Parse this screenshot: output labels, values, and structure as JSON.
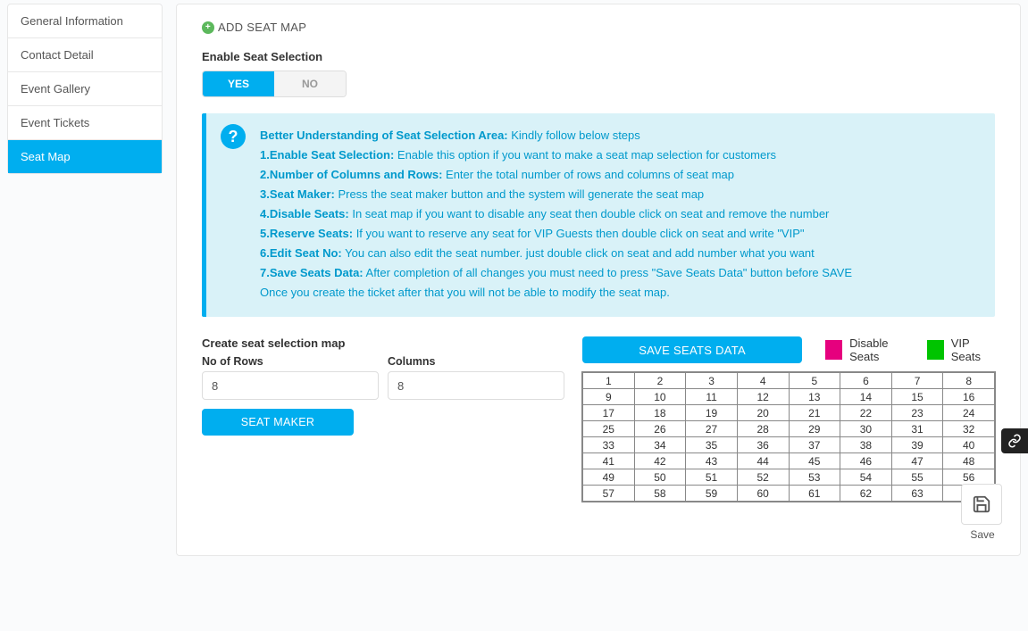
{
  "sidebar": {
    "items": [
      {
        "label": "General Information",
        "key": "general-information"
      },
      {
        "label": "Contact Detail",
        "key": "contact-detail"
      },
      {
        "label": "Event Gallery",
        "key": "event-gallery"
      },
      {
        "label": "Event Tickets",
        "key": "event-tickets"
      },
      {
        "label": "Seat Map",
        "key": "seat-map"
      }
    ],
    "active_index": 4
  },
  "panel": {
    "title": "ADD SEAT MAP",
    "enable_label": "Enable Seat Selection",
    "toggle_yes": "YES",
    "toggle_no": "NO",
    "toggle_value": "YES"
  },
  "info": {
    "heading_bold": "Better Understanding of Seat Selection Area:",
    "heading_rest": " Kindly follow below steps",
    "steps": [
      {
        "b": "1.Enable Seat Selection:",
        "t": " Enable this option if you want to make a seat map selection for customers"
      },
      {
        "b": "2.Number of Columns and Rows:",
        "t": " Enter the total number of rows and columns of seat map"
      },
      {
        "b": "3.Seat Maker:",
        "t": " Press the seat maker button and the system will generate the seat map"
      },
      {
        "b": "4.Disable Seats:",
        "t": " In seat map if you want to disable any seat then double click on seat and remove the number"
      },
      {
        "b": "5.Reserve Seats:",
        "t": " If you want to reserve any seat for VIP Guests then double click on seat and write \"VIP\""
      },
      {
        "b": "6.Edit Seat No:",
        "t": " You can also edit the seat number. just double click on seat and add number what you want"
      },
      {
        "b": "7.Save Seats Data:",
        "t": " After completion of all changes you must need to press \"Save Seats Data\" button before SAVE"
      }
    ],
    "footer": "Once you create the ticket after that you will not be able to modify the seat map."
  },
  "controls": {
    "title": "Create seat selection map",
    "rows_label": "No of Rows",
    "cols_label": "Columns",
    "rows_value": "8",
    "cols_value": "8",
    "seat_maker_btn": "SEAT MAKER"
  },
  "seat_area": {
    "save_btn": "SAVE SEATS DATA",
    "legend_disable": "Disable Seats",
    "legend_vip": "VIP Seats",
    "rows": 8,
    "cols": 8
  },
  "save_fab": "Save",
  "colors": {
    "primary": "#00aeef",
    "disable_swatch": "#e6007e",
    "vip_swatch": "#00c400"
  }
}
